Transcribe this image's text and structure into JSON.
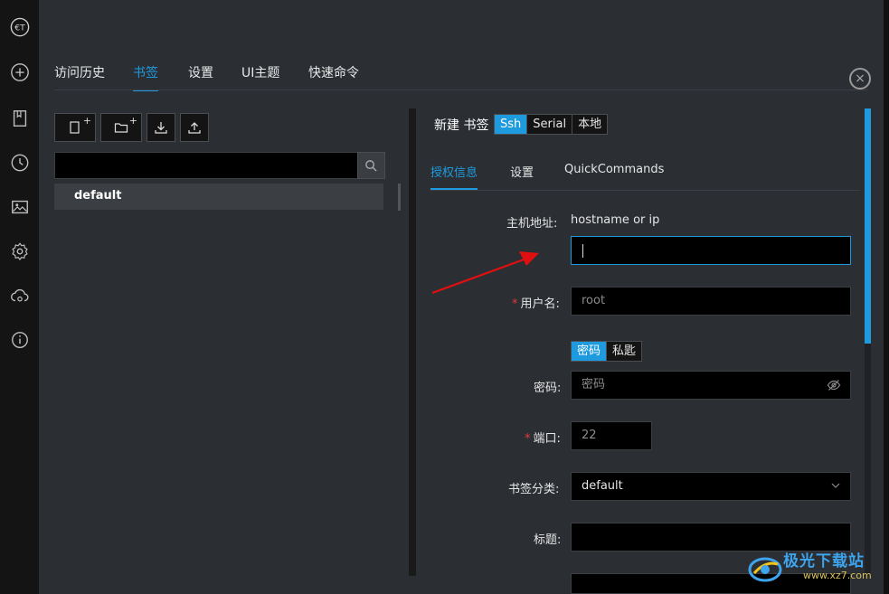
{
  "app": {
    "logo_text": "€T"
  },
  "top_tabs": [
    {
      "label": "访问历史"
    },
    {
      "label": "书签"
    },
    {
      "label": "设置"
    },
    {
      "label": "UI主题"
    },
    {
      "label": "快速命令"
    }
  ],
  "close_icon": "×",
  "bookmarks": {
    "search_value": "",
    "tree": [
      {
        "label": "default"
      }
    ]
  },
  "form": {
    "title": "新建 书签",
    "types": [
      {
        "label": "Ssh"
      },
      {
        "label": "Serial"
      },
      {
        "label": "本地"
      }
    ],
    "sub_tabs": [
      {
        "label": "授权信息"
      },
      {
        "label": "设置"
      },
      {
        "label": "QuickCommands"
      }
    ],
    "host_label": "主机地址:",
    "host_hint": "hostname or ip",
    "host_value": "",
    "username_label": "用户名:",
    "username_placeholder": "root",
    "auth_types": [
      {
        "label": "密码"
      },
      {
        "label": "私匙"
      }
    ],
    "password_label": "密码:",
    "password_placeholder": "密码",
    "port_label": "端口:",
    "port_placeholder": "22",
    "category_label": "书签分类:",
    "category_value": "default",
    "title_label": "标题:",
    "title_value": ""
  },
  "watermark": {
    "text": "极光下载站",
    "url": "www.xz7.com"
  },
  "colors": {
    "accent": "#1e9bde",
    "required": "#e23b3b",
    "arrow": "#e01010"
  }
}
